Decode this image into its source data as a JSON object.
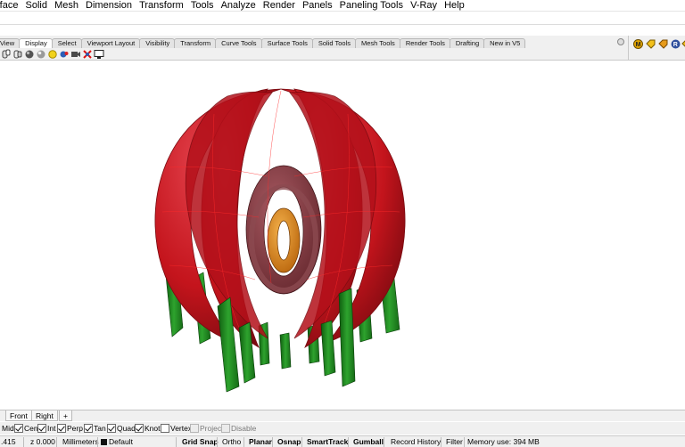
{
  "menu": [
    "rface",
    "Solid",
    "Mesh",
    "Dimension",
    "Transform",
    "Tools",
    "Analyze",
    "Render",
    "Panels",
    "Paneling Tools",
    "V-Ray",
    "Help"
  ],
  "toolbar_tabs": [
    "View",
    "Display",
    "Select",
    "Viewport Layout",
    "Visibility",
    "Transform",
    "Curve Tools",
    "Surface Tools",
    "Solid Tools",
    "Mesh Tools",
    "Render Tools",
    "Drafting",
    "New in V5"
  ],
  "active_tab": "Display",
  "viewport_tabs": [
    "Front",
    "Right"
  ],
  "viewport_add_label": "+",
  "osnaps": [
    {
      "label": "Mid",
      "checked": true
    },
    {
      "label": "Cen",
      "checked": true
    },
    {
      "label": "Int",
      "checked": true
    },
    {
      "label": "Perp",
      "checked": true
    },
    {
      "label": "Tan",
      "checked": true
    },
    {
      "label": "Quad",
      "checked": true
    },
    {
      "label": "Knot",
      "checked": true
    },
    {
      "label": "Vertex",
      "checked": false
    },
    {
      "label": "Project",
      "checked": false,
      "disabled": true
    },
    {
      "label": "Disable",
      "checked": false,
      "disabled": true
    }
  ],
  "status": {
    "x": ".415",
    "z": "z 0.000",
    "units": "Millimeters",
    "layer": "Default",
    "layer_color": "#111111",
    "grid_snap": "Grid Snap",
    "ortho": "Ortho",
    "planar": "Planar",
    "osnap": "Osnap",
    "smarttrack": "SmartTrack",
    "gumball": "Gumball",
    "record_history": "Record History",
    "filter": "Filter",
    "memory": "Memory use: 394 MB"
  },
  "colors": {
    "torus_red": "#c8141c",
    "inner_torus": "#7a3036",
    "core_orange": "#d97a12",
    "legs_green": "#1f8a1f"
  },
  "icons": [
    "view-icon",
    "display-mode-icon",
    "shaded-sphere-icon",
    "rendered-sphere-icon",
    "light-bulb-icon",
    "camera-icon",
    "render-preview-icon",
    "close-icon",
    "monitor-icon"
  ]
}
